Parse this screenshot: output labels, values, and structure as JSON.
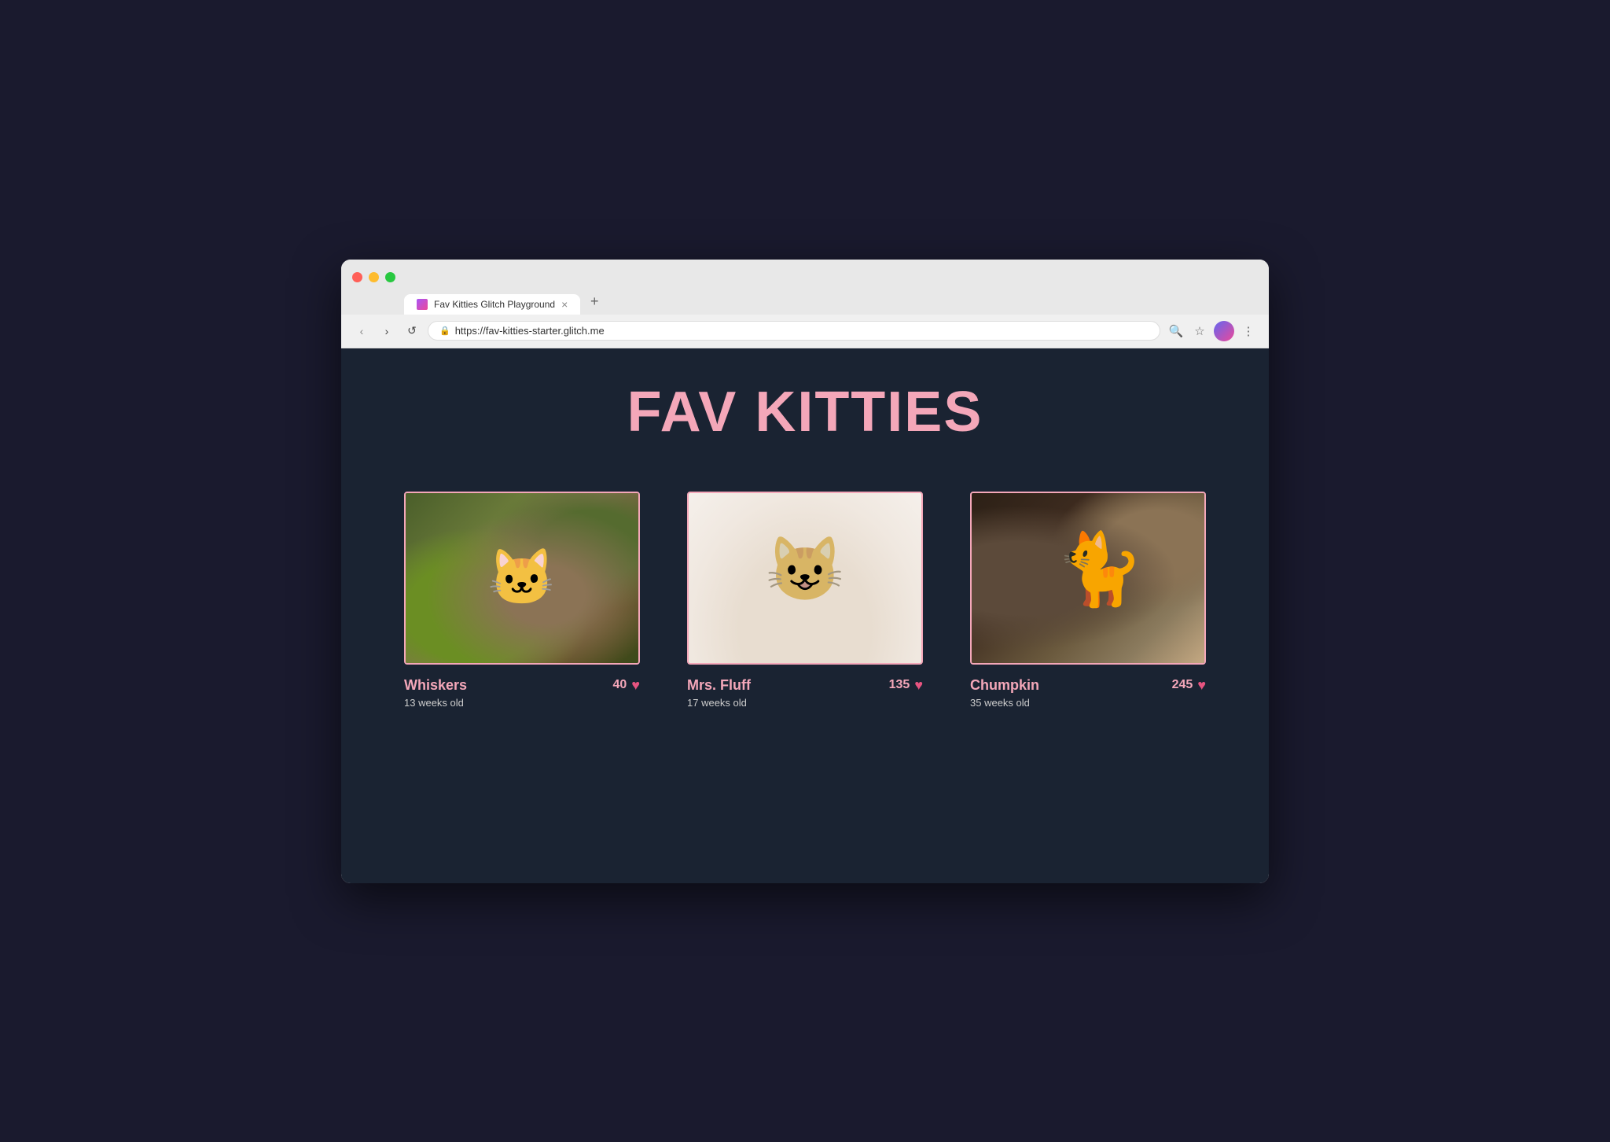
{
  "browser": {
    "tab_title": "Fav Kitties Glitch Playground",
    "tab_close": "×",
    "tab_new": "+",
    "url": "https://fav-kitties-starter.glitch.me",
    "back_btn": "‹",
    "forward_btn": "›",
    "refresh_btn": "↺"
  },
  "page": {
    "title": "FAV KITTIES",
    "accent_color": "#f4a7b9",
    "bg_color": "#1a2332"
  },
  "kitties": [
    {
      "name": "Whiskers",
      "age": "13 weeks old",
      "likes": "40",
      "image_class": "kitty-1"
    },
    {
      "name": "Mrs. Fluff",
      "age": "17 weeks old",
      "likes": "135",
      "image_class": "kitty-2"
    },
    {
      "name": "Chumpkin",
      "age": "35 weeks old",
      "likes": "245",
      "image_class": "kitty-3"
    }
  ]
}
